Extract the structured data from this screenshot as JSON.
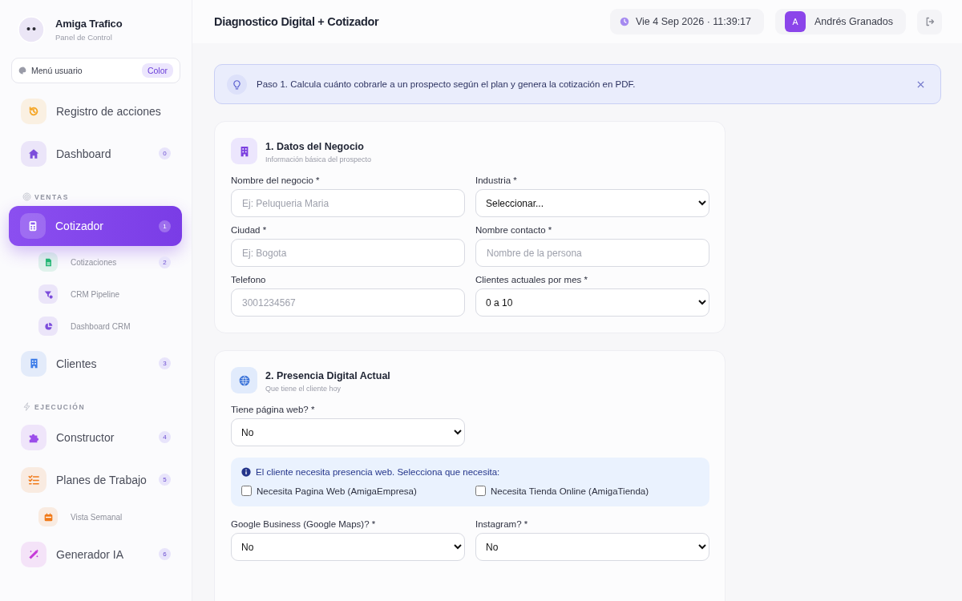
{
  "sidebar": {
    "brand": {
      "name": "Amiga Trafico",
      "subtitle": "Panel de Control"
    },
    "user_menu": {
      "label": "Menú usuario",
      "badge": "Color"
    },
    "nav": [
      {
        "kind": "item",
        "label": "Registro de acciones",
        "color": "#f5a524",
        "selected": false
      },
      {
        "kind": "item",
        "label": "Dashboard",
        "badge": "0",
        "color": "#7c4ddb",
        "selected": false
      },
      {
        "kind": "section",
        "label": "VENTAS"
      },
      {
        "kind": "item",
        "label": "Cotizador",
        "badge": "1",
        "color": "#ffffff",
        "selected": true
      },
      {
        "kind": "subitem",
        "label": "Cotizaciones",
        "badge": "2",
        "color": "#22b573",
        "selected": false
      },
      {
        "kind": "subitem",
        "label": "CRM Pipeline",
        "color": "#7c4ddb",
        "selected": false
      },
      {
        "kind": "subitem",
        "label": "Dashboard CRM",
        "color": "#7c4ddb",
        "selected": false
      },
      {
        "kind": "item",
        "label": "Clientes",
        "badge": "3",
        "color": "#3b7be8",
        "selected": false
      },
      {
        "kind": "section",
        "label": "EJECUCIÓN"
      },
      {
        "kind": "item",
        "label": "Constructor",
        "badge": "4",
        "color": "#9b4dea",
        "selected": false
      },
      {
        "kind": "item",
        "label": "Planes de Trabajo",
        "badge": "5",
        "color": "#f07a1a",
        "selected": false
      },
      {
        "kind": "subitem",
        "label": "Vista Semanal",
        "color": "#f07a1a",
        "selected": false
      },
      {
        "kind": "item",
        "label": "Generador IA",
        "badge": "6",
        "color": "#c63ad8",
        "selected": false
      }
    ]
  },
  "header": {
    "title": "Diagnostico Digital + Cotizador",
    "datetime": "Vie 4 Sep 2026 · 11:39:17",
    "user": {
      "initial": "A",
      "name": "Andrés Granados"
    }
  },
  "banner": {
    "text": "Paso 1. Calcula cuánto cobrarle a un prospecto según el plan y genera la cotización en PDF."
  },
  "cards": [
    {
      "title": "1. Datos del Negocio",
      "subtitle": "Información básica del prospecto",
      "items": [
        {
          "kind": "input",
          "label": "Nombre del negocio *",
          "placeholder": "Ej: Peluqueria Maria"
        },
        {
          "kind": "select",
          "label": "Industria *",
          "value": "Seleccionar..."
        },
        {
          "kind": "input",
          "label": "Ciudad *",
          "placeholder": "Ej: Bogota"
        },
        {
          "kind": "input",
          "label": "Nombre contacto *",
          "placeholder": "Nombre de la persona"
        },
        {
          "kind": "input",
          "label": "Telefono",
          "placeholder": "3001234567"
        },
        {
          "kind": "select",
          "label": "Clientes actuales por mes *",
          "value": "0 a 10"
        }
      ]
    },
    {
      "title": "2. Presencia Digital Actual",
      "subtitle": "Que tiene el cliente hoy",
      "items": [
        {
          "kind": "select",
          "label": "Tiene página web? *",
          "value": "No"
        },
        {
          "kind": "notice",
          "text": "El cliente necesita presencia web. Selecciona que necesita:",
          "options": [
            {
              "label": "Necesita Pagina Web (AmigaEmpresa)",
              "checked": false
            },
            {
              "label": "Necesita Tienda Online (AmigaTienda)",
              "checked": false
            }
          ]
        },
        {
          "kind": "select",
          "label": "Google Business (Google Maps)? *",
          "value": "No"
        },
        {
          "kind": "select",
          "label": "Instagram? *",
          "value": "No"
        }
      ]
    }
  ]
}
